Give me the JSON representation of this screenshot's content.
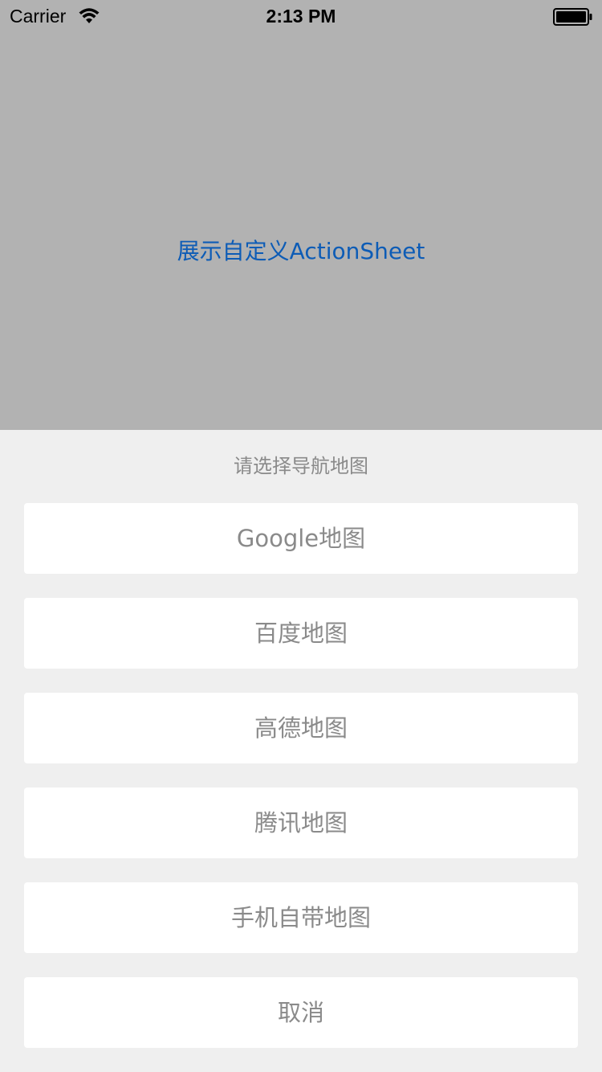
{
  "status_bar": {
    "carrier": "Carrier",
    "time": "2:13 PM",
    "wifi_icon": "wifi-icon",
    "battery_icon": "battery-icon"
  },
  "main": {
    "show_button_label": "展示自定义ActionSheet",
    "accent_color": "#0d5cb6",
    "background_color": "#b2b2b2"
  },
  "action_sheet": {
    "title": "请选择导航地图",
    "options": [
      {
        "label": "Google地图"
      },
      {
        "label": "百度地图"
      },
      {
        "label": "高德地图"
      },
      {
        "label": "腾讯地图"
      },
      {
        "label": "手机自带地图"
      }
    ],
    "cancel_label": "取消",
    "sheet_color": "#efefef",
    "option_text_color": "#8a8a8a"
  }
}
